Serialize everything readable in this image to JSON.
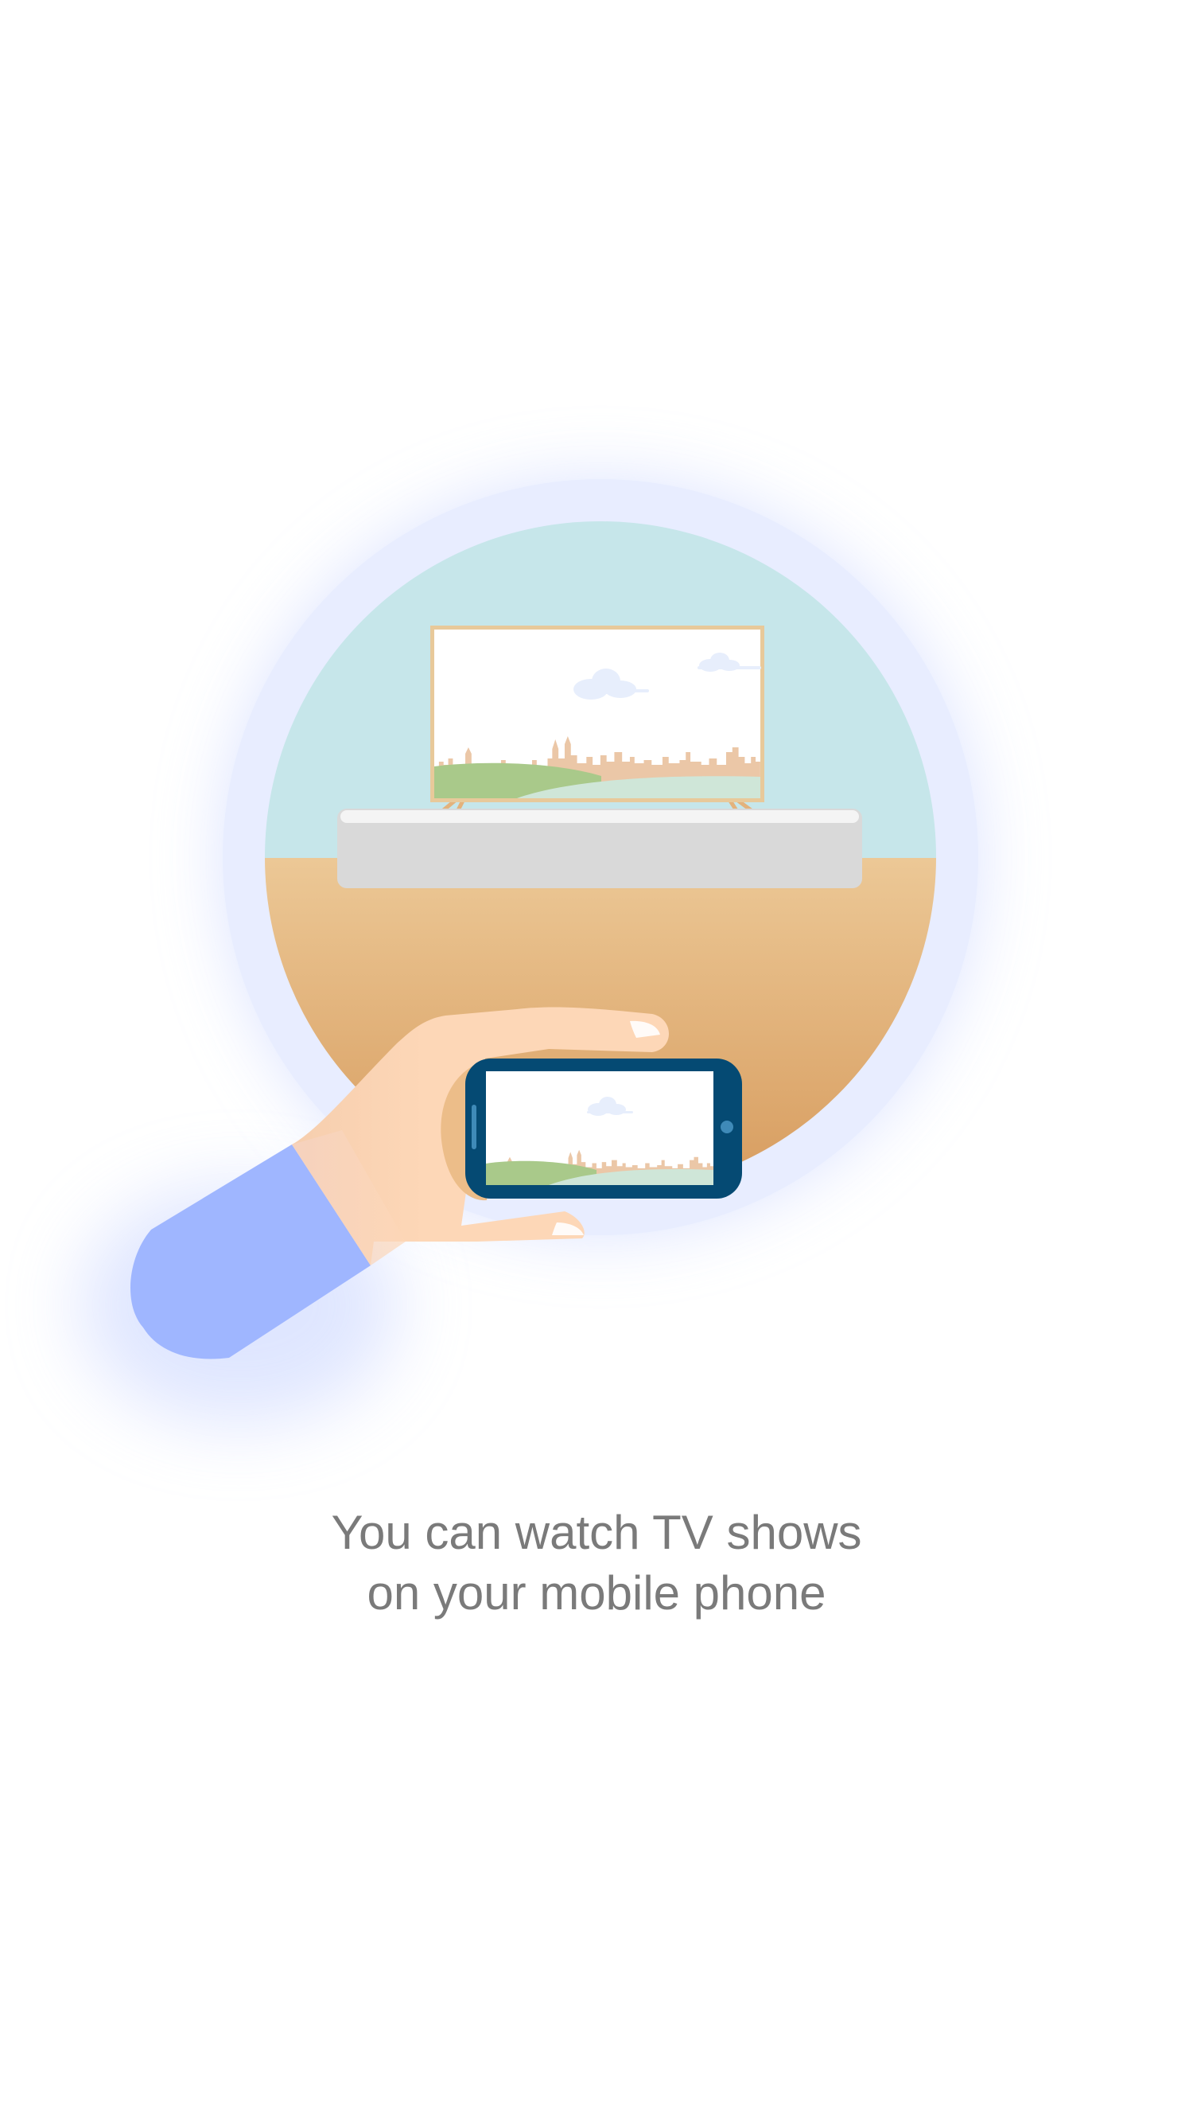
{
  "caption": {
    "line1": "You can watch TV shows",
    "line2": "on your mobile phone"
  },
  "colors": {
    "background": "#ffffff",
    "halo": "#e8edff",
    "glow": "#c9d4ff",
    "sky": "#c6e6ea",
    "floor_top": "#ecc896",
    "floor_bottom": "#d69a5c",
    "tv_frame": "#e8c99a",
    "tv_screen": "#ffffff",
    "cabinet": "#d9d9d9",
    "cabinet_top": "#f2f2f2",
    "hill_green": "#a9c98a",
    "hill_mint": "#cfe6d8",
    "skyline": "#ebc7a7",
    "cloud": "#e7eefc",
    "skin": "#fdd7b7",
    "skin_shadow": "#ecbd89",
    "sleeve": "#9fb6ff",
    "phone_body": "#054a73",
    "caption_text": "#7a7a7a"
  }
}
